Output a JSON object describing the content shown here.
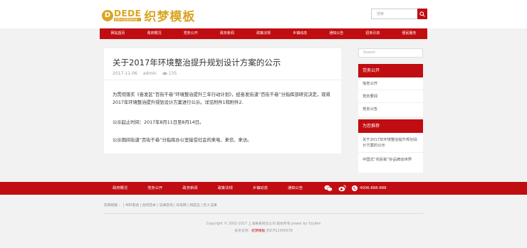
{
  "header": {
    "logo_mark": "D",
    "logo_en": "DEDE",
    "logo_en_small": "织梦内容管理系统",
    "logo_cn": "织梦模板",
    "search_placeholder": "搜索"
  },
  "nav": {
    "items": [
      "网站首页",
      "政府概况",
      "党务公开",
      "政务新闻",
      "政策法规",
      "乡镇动态",
      "通知公告",
      "招商引资",
      "便民服务"
    ]
  },
  "article": {
    "title": "关于2017年环境整治提升规划设计方案的公示",
    "date": "2017-11-06",
    "author": "admin",
    "views": "135",
    "p1": "为贯彻落实《奋发区“百街千巷”环境整治提升三年行动计划》，经奋发街道“百街千巷”分指挥部研究决定，现将2017年环境整治提升规划设计方案进行公示。详见附件1和附件2.",
    "p2": "公示起止时间：2017年8月11日至8月14日。",
    "p3": "公示期间街道“百街千巷”分指挥办公室接受社会的来电、来信、来访。"
  },
  "sidebar": {
    "search_placeholder": "Search",
    "widget1": {
      "title": "党务公开",
      "items": [
        "信息公开",
        "党务要闻",
        "党务公告"
      ]
    },
    "widget2": {
      "title": "为您推荐",
      "items": [
        "关于2017年环境整治提升规划设计方案的公示",
        "中国式“农民街”好品牌动世界"
      ]
    }
  },
  "footer": {
    "nav": [
      "政府概况",
      "党务公开",
      "政务新闻",
      "政策法规",
      "乡镇动态",
      "通知公告"
    ],
    "phone": "4006-888-888",
    "links": "友情链接 ： | 400电话 | 合同范本 | 法律咨询 | 日号网 | 和田玉 | 巨人法律",
    "copyright": "Copyright © 2002-2017 上海某某商贸公司 版权所有 power by Yzjufen",
    "support_prefix": "技术支持：",
    "support_name": "织梦模板",
    "icp": "苏ICP12345678"
  },
  "colors": {
    "brand_red": "#c00d12",
    "logo_gold": "#d9a521"
  }
}
